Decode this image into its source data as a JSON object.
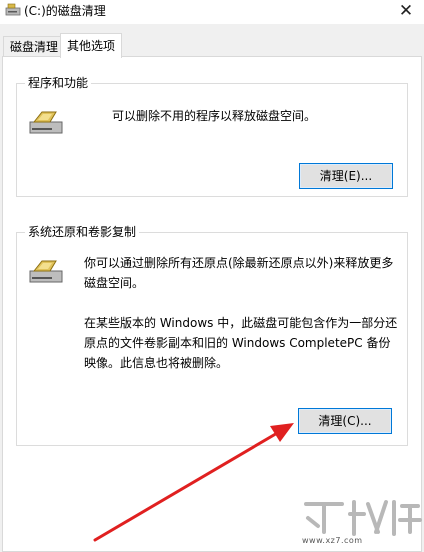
{
  "window": {
    "title": "(C:)的磁盘清理",
    "close_glyph": "✕"
  },
  "tabs": [
    {
      "label": "磁盘清理",
      "active": false
    },
    {
      "label": "其他选项",
      "active": true
    }
  ],
  "programs_group": {
    "title": "程序和功能",
    "description": "可以删除不用的程序以释放磁盘空间。",
    "button_label": "清理(E)..."
  },
  "restore_group": {
    "title": "系统还原和卷影复制",
    "description_lines": [
      "你可以通过删除所有还原点(除最新还原点以外)来释放更多",
      "磁盘空间。"
    ],
    "note_lines": [
      "在某些版本的 Windows 中，此磁盘可能包含作为一部分还",
      "原点的文件卷影副本和旧的 Windows CompletePC 备份",
      "映像。此信息也将被删除。"
    ],
    "button_label": "清理(C)..."
  },
  "watermark": {
    "text": "www.xz7.com"
  },
  "colors": {
    "button_border": "#0078d7",
    "arrow": "#e02020",
    "window_bg": "#f0f0f0"
  }
}
